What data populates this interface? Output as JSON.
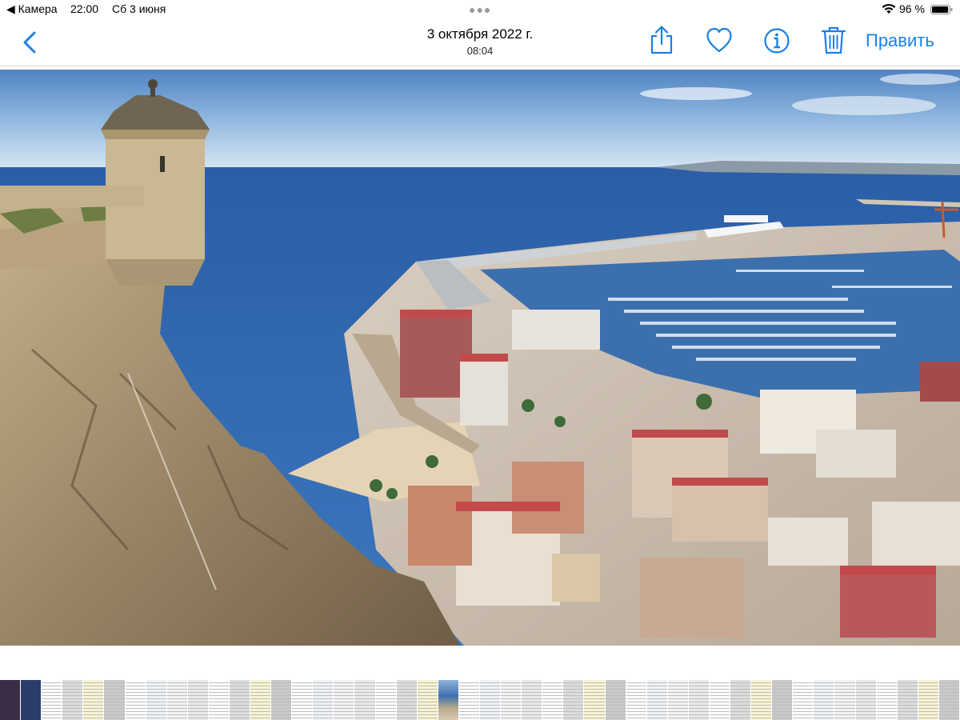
{
  "status_bar": {
    "back_app": "◀ Камера",
    "time": "22:00",
    "date": "Сб 3 июня",
    "battery_text": "96 %",
    "battery_level": 0.96
  },
  "nav": {
    "title": "3 октября 2022 г.",
    "subtitle": "08:04",
    "edit_label": "Править",
    "icons": [
      "chevron-left-icon",
      "share-icon",
      "heart-icon",
      "info-icon",
      "trash-icon"
    ],
    "accent": "#1a7fe6"
  },
  "photo": {
    "subject": "coastal-city-view-icon"
  },
  "thumbnails": {
    "selected_index": 21,
    "count": 46
  }
}
